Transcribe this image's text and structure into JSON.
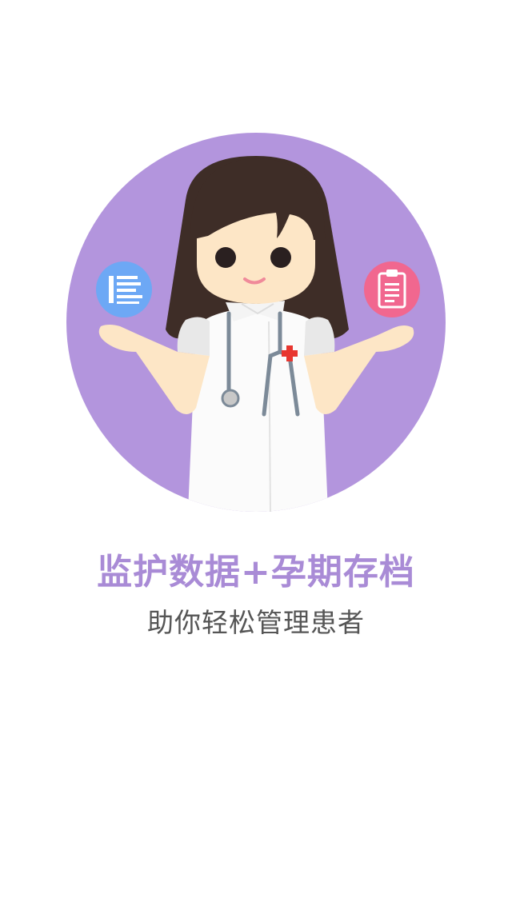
{
  "slide": {
    "headline": "监护数据+孕期存档",
    "subline": "助你轻松管理患者"
  },
  "colors": {
    "background": "#ffffff",
    "circle": "#b395dd",
    "headline": "#a98bd6",
    "subline": "#555555",
    "hair": "#3e2d27",
    "skin": "#fde6c6",
    "coat": "#fbfbfb",
    "left_badge": "#6da8f5",
    "right_badge": "#f1678f",
    "cross": "#e8362f"
  },
  "icons": {
    "left": "list-document-icon",
    "right": "clipboard-icon"
  }
}
